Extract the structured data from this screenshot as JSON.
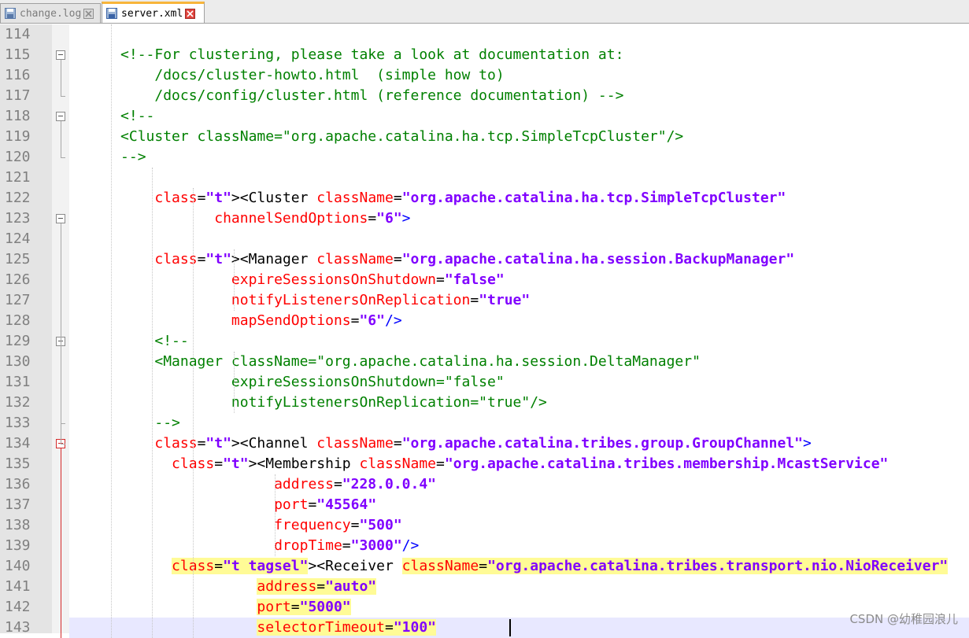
{
  "tabs": [
    {
      "label": "change.log",
      "state": "inactive"
    },
    {
      "label": "server.xml",
      "state": "active"
    }
  ],
  "lines": [
    {
      "n": "114",
      "text": ""
    },
    {
      "n": "115",
      "text": "      <!--For clustering, please take a look at documentation at:"
    },
    {
      "n": "116",
      "text": "          /docs/cluster-howto.html  (simple how to)"
    },
    {
      "n": "117",
      "text": "          /docs/config/cluster.html (reference documentation) -->"
    },
    {
      "n": "118",
      "text": "      <!--"
    },
    {
      "n": "119",
      "text": "      <Cluster className=\"org.apache.catalina.ha.tcp.SimpleTcpCluster\"/>"
    },
    {
      "n": "120",
      "text": "      -->"
    },
    {
      "n": "121",
      "text": ""
    },
    {
      "n": "122",
      "text": "          <Cluster className=\"org.apache.catalina.ha.tcp.SimpleTcpCluster\""
    },
    {
      "n": "123",
      "text": "                 channelSendOptions=\"6\">"
    },
    {
      "n": "124",
      "text": ""
    },
    {
      "n": "125",
      "text": "          <Manager className=\"org.apache.catalina.ha.session.BackupManager\""
    },
    {
      "n": "126",
      "text": "                   expireSessionsOnShutdown=\"false\""
    },
    {
      "n": "127",
      "text": "                   notifyListenersOnReplication=\"true\""
    },
    {
      "n": "128",
      "text": "                   mapSendOptions=\"6\"/>"
    },
    {
      "n": "129",
      "text": "          <!--"
    },
    {
      "n": "130",
      "text": "          <Manager className=\"org.apache.catalina.ha.session.DeltaManager\""
    },
    {
      "n": "131",
      "text": "                   expireSessionsOnShutdown=\"false\""
    },
    {
      "n": "132",
      "text": "                   notifyListenersOnReplication=\"true\"/>"
    },
    {
      "n": "133",
      "text": "          -->"
    },
    {
      "n": "134",
      "text": "          <Channel className=\"org.apache.catalina.tribes.group.GroupChannel\">"
    },
    {
      "n": "135",
      "text": "            <Membership className=\"org.apache.catalina.tribes.membership.McastService\""
    },
    {
      "n": "136",
      "text": "                        address=\"228.0.0.4\""
    },
    {
      "n": "137",
      "text": "                        port=\"45564\""
    },
    {
      "n": "138",
      "text": "                        frequency=\"500\""
    },
    {
      "n": "139",
      "text": "                        dropTime=\"3000\"/>"
    },
    {
      "n": "140",
      "text": "            <Receiver className=\"org.apache.catalina.tribes.transport.nio.NioReceiver\""
    },
    {
      "n": "141",
      "text": "                      address=\"auto\""
    },
    {
      "n": "142",
      "text": "                      port=\"5000\""
    },
    {
      "n": "143",
      "text": "                      selectorTimeout=\"100\""
    }
  ],
  "watermark": "CSDN @幼稚园浪儿"
}
